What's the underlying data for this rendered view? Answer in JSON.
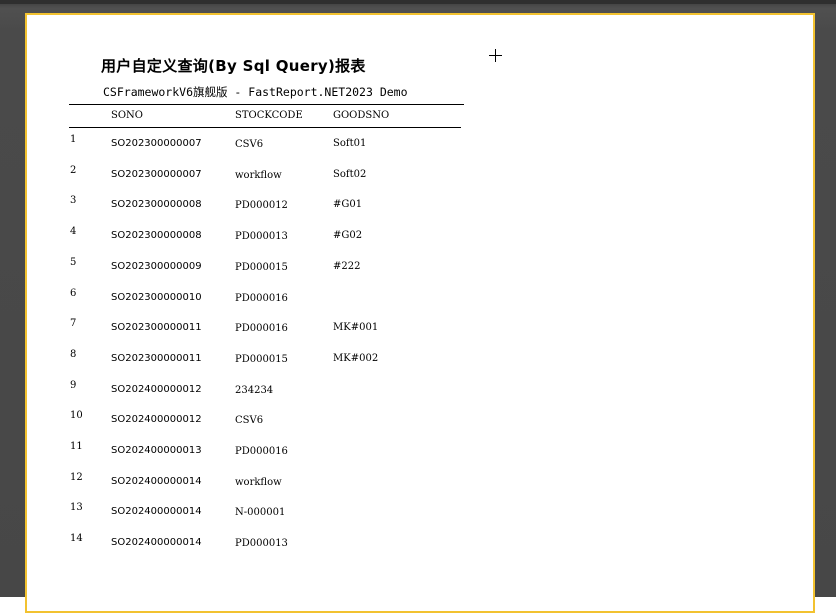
{
  "report": {
    "title": "用户自定义查询(By Sql Query)报表",
    "subtitle": "CSFrameworkV6旗舰版 - FastReport.NET2023 Demo",
    "columns": [
      "SONO",
      "STOCKCODE",
      "GOODSNO"
    ],
    "rows": [
      {
        "index": "1",
        "sono": "SO202300000007",
        "stockcode": "CSV6",
        "goodsno": "Soft01"
      },
      {
        "index": "2",
        "sono": "SO202300000007",
        "stockcode": "workflow",
        "goodsno": "Soft02"
      },
      {
        "index": "3",
        "sono": "SO202300000008",
        "stockcode": "PD000012",
        "goodsno": "#G01"
      },
      {
        "index": "4",
        "sono": "SO202300000008",
        "stockcode": "PD000013",
        "goodsno": "#G02"
      },
      {
        "index": "5",
        "sono": "SO202300000009",
        "stockcode": "PD000015",
        "goodsno": "#222"
      },
      {
        "index": "6",
        "sono": "SO202300000010",
        "stockcode": "PD000016",
        "goodsno": ""
      },
      {
        "index": "7",
        "sono": "SO202300000011",
        "stockcode": "PD000016",
        "goodsno": "MK#001"
      },
      {
        "index": "8",
        "sono": "SO202300000011",
        "stockcode": "PD000015",
        "goodsno": "MK#002"
      },
      {
        "index": "9",
        "sono": "SO202400000012",
        "stockcode": "234234",
        "goodsno": ""
      },
      {
        "index": "10",
        "sono": "SO202400000012",
        "stockcode": "CSV6",
        "goodsno": ""
      },
      {
        "index": "11",
        "sono": "SO202400000013",
        "stockcode": "PD000016",
        "goodsno": ""
      },
      {
        "index": "12",
        "sono": "SO202400000014",
        "stockcode": "workflow",
        "goodsno": ""
      },
      {
        "index": "13",
        "sono": "SO202400000014",
        "stockcode": "N-000001",
        "goodsno": ""
      },
      {
        "index": "14",
        "sono": "SO202400000014",
        "stockcode": "PD000013",
        "goodsno": ""
      }
    ]
  },
  "colors": {
    "viewer_background": "#474747",
    "page_border": "#f2c230",
    "page_background": "#ffffff"
  },
  "cursor": {
    "icon": "crosshair-icon"
  }
}
